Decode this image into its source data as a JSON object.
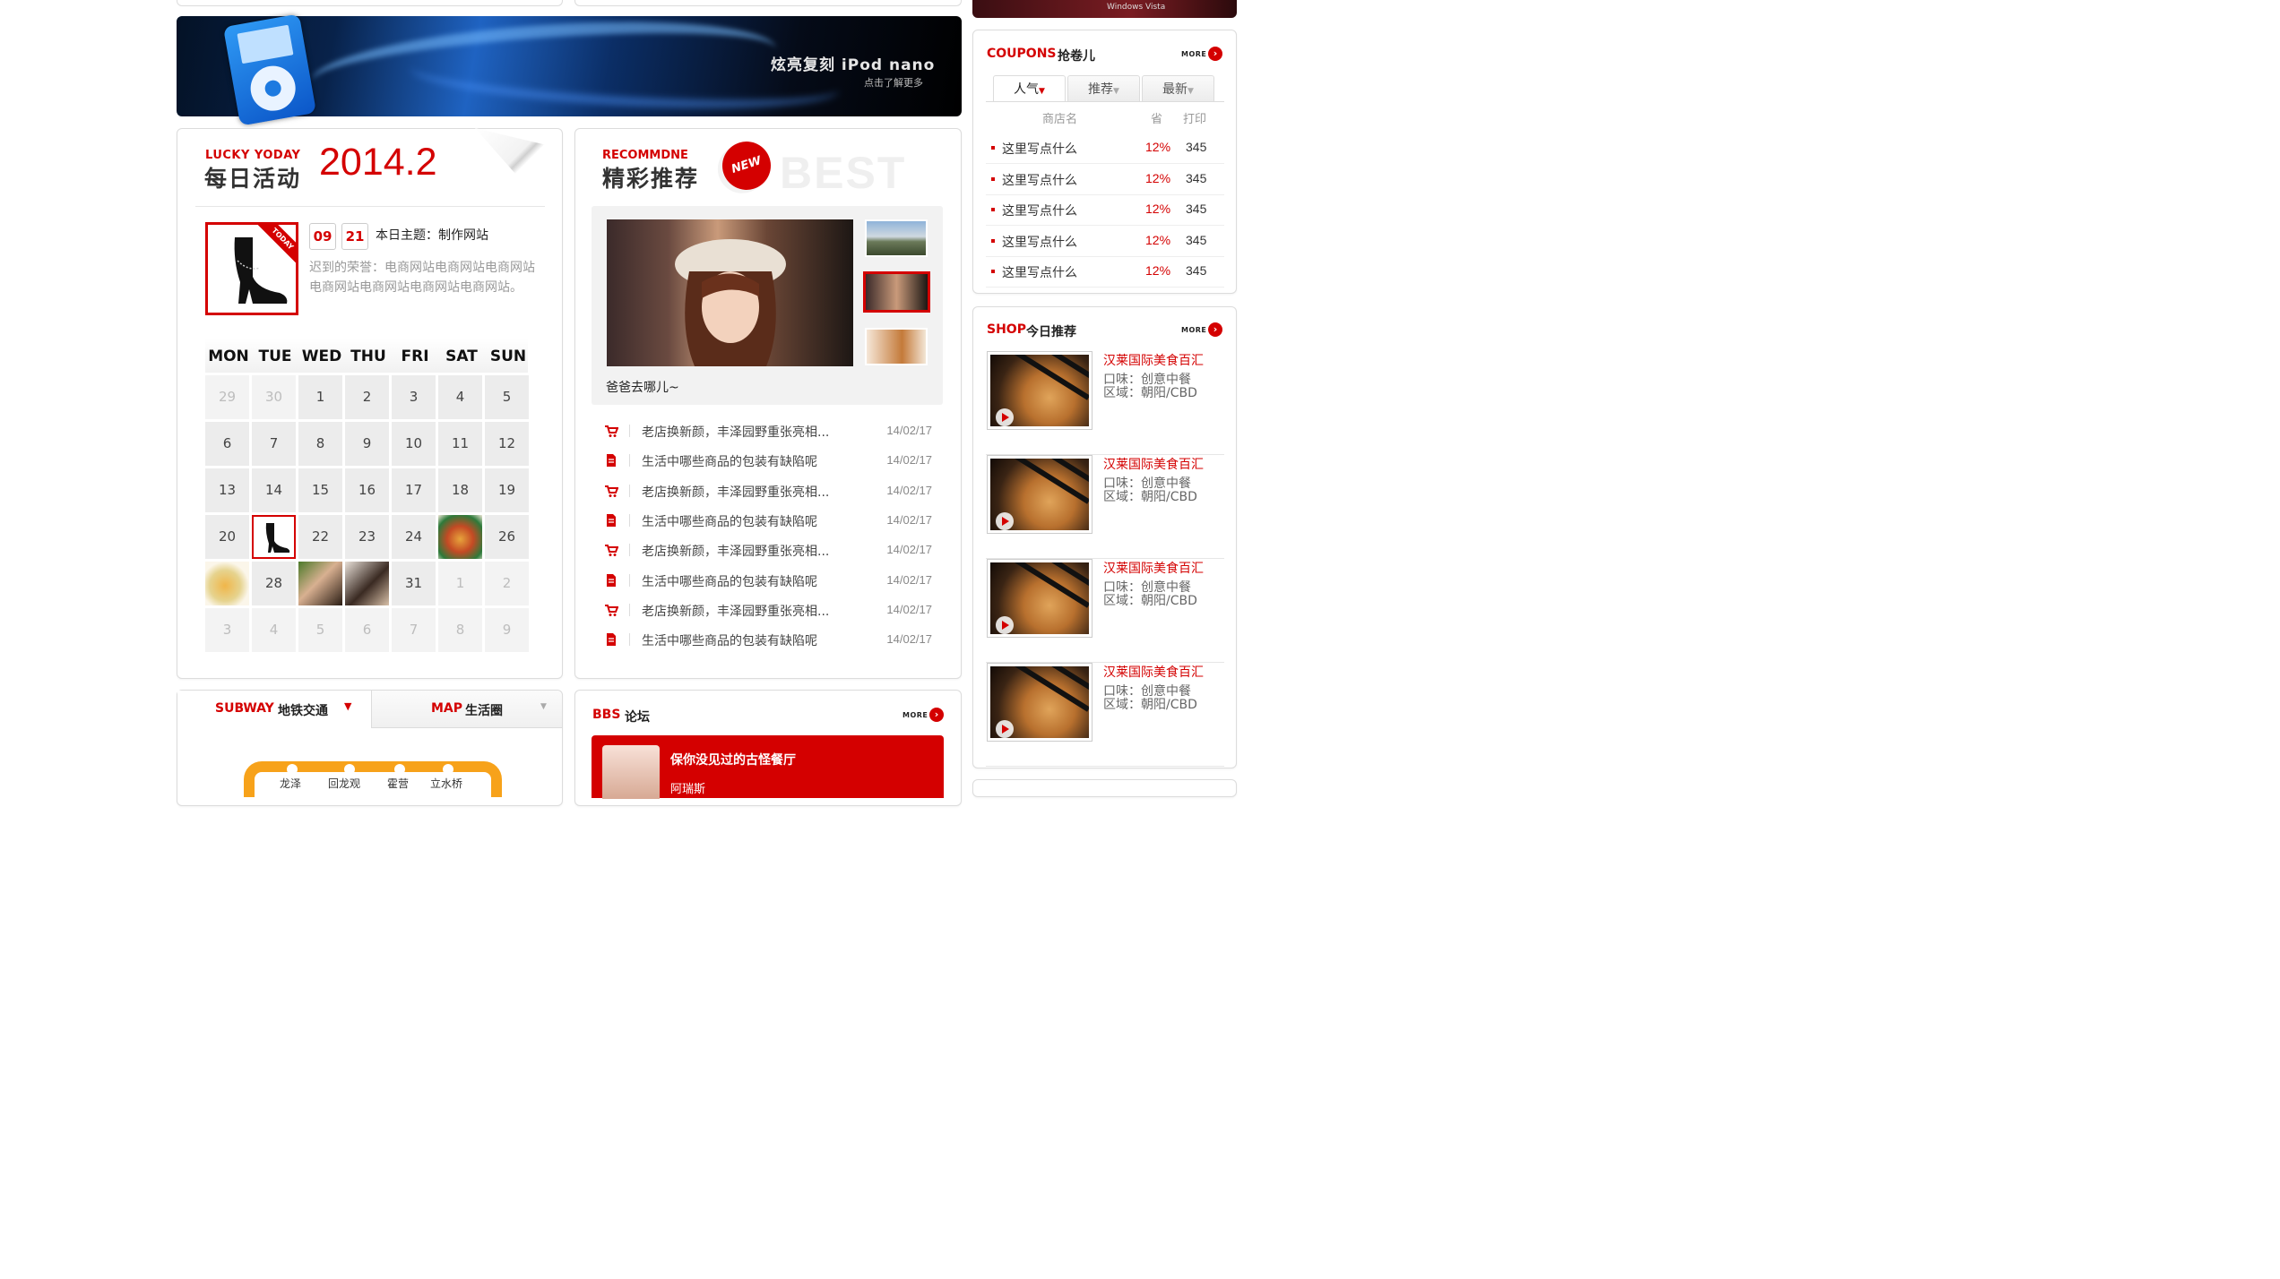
{
  "banner": {
    "text": "炫亮复刻  iPod nano",
    "sub": "点击了解更多",
    "top_right_brand": "Windows Vista"
  },
  "lucky": {
    "en_title": "LUCKY YODAY",
    "cn_title": "每日活动",
    "date": "2014.2",
    "today_badge": "TODAY",
    "month": "09",
    "day": "21",
    "theme": "本日主题：制作网站",
    "desc": "迟到的荣誉：电商网站电商网站电商网站电商网站电商网站电商网站电商网站。",
    "weekdays": [
      "MON",
      "TUE",
      "WED",
      "THU",
      "FRI",
      "SAT",
      "SUN"
    ],
    "calendar": [
      [
        "29",
        "30",
        "1",
        "2",
        "3",
        "4",
        "5"
      ],
      [
        "6",
        "7",
        "8",
        "9",
        "10",
        "11",
        "12"
      ],
      [
        "13",
        "14",
        "15",
        "16",
        "17",
        "18",
        "19"
      ],
      [
        "20",
        "",
        "22",
        "23",
        "24",
        "",
        "26"
      ],
      [
        "",
        "28",
        "",
        "",
        "31",
        "1",
        "2"
      ],
      [
        "3",
        "4",
        "5",
        "6",
        "7",
        "8",
        "9"
      ]
    ]
  },
  "recommend": {
    "en_title": "RECOMMDNE",
    "cn_title": "精彩推荐",
    "badge": "NEW",
    "watermark": "BEST",
    "caption": "爸爸去哪儿~",
    "news": [
      {
        "icon": "cart-icon",
        "title": "老店换新颜，丰泽园野重张亮相...",
        "date": "14/02/17"
      },
      {
        "icon": "doc-icon",
        "title": "生活中哪些商品的包装有缺陷呢",
        "date": "14/02/17"
      },
      {
        "icon": "cart-icon",
        "title": "老店换新颜，丰泽园野重张亮相...",
        "date": "14/02/17"
      },
      {
        "icon": "doc-icon",
        "title": "生活中哪些商品的包装有缺陷呢",
        "date": "14/02/17"
      },
      {
        "icon": "cart-icon",
        "title": "老店换新颜，丰泽园野重张亮相...",
        "date": "14/02/17"
      },
      {
        "icon": "doc-icon",
        "title": "生活中哪些商品的包装有缺陷呢",
        "date": "14/02/17"
      },
      {
        "icon": "cart-icon",
        "title": "老店换新颜，丰泽园野重张亮相...",
        "date": "14/02/17"
      },
      {
        "icon": "doc-icon",
        "title": "生活中哪些商品的包装有缺陷呢",
        "date": "14/02/17"
      }
    ]
  },
  "subway_tabs": {
    "subway_en": "SUBWAY",
    "subway_cn": "地铁交通",
    "map_en": "MAP",
    "map_cn": "生活圈",
    "stations": [
      "龙泽",
      "回龙观",
      "霍营",
      "立水桥"
    ]
  },
  "bbs": {
    "en": "BBS",
    "cn": "论坛",
    "more": "MORE",
    "headline": "保你没见过的古怪餐厅",
    "author": "阿瑞斯"
  },
  "coupons": {
    "en": "COUPONS",
    "cn": "抢卷儿",
    "more": "MORE",
    "tabs": [
      "人气",
      "推荐",
      "最新"
    ],
    "headers": {
      "name": "商店名",
      "save": "省",
      "print": "打印"
    },
    "rows": [
      {
        "name": "这里写点什么",
        "save": "12%",
        "print": "345"
      },
      {
        "name": "这里写点什么",
        "save": "12%",
        "print": "345"
      },
      {
        "name": "这里写点什么",
        "save": "12%",
        "print": "345"
      },
      {
        "name": "这里写点什么",
        "save": "12%",
        "print": "345"
      },
      {
        "name": "这里写点什么",
        "save": "12%",
        "print": "345"
      }
    ]
  },
  "shop": {
    "en": "SHOP",
    "cn": "今日推荐",
    "more": "MORE",
    "items": [
      {
        "name": "汉莱国际美食百汇",
        "taste": "口味：创意中餐",
        "area": "区域：朝阳/CBD"
      },
      {
        "name": "汉莱国际美食百汇",
        "taste": "口味：创意中餐",
        "area": "区域：朝阳/CBD"
      },
      {
        "name": "汉莱国际美食百汇",
        "taste": "口味：创意中餐",
        "area": "区域：朝阳/CBD"
      },
      {
        "name": "汉莱国际美食百汇",
        "taste": "口味：创意中餐",
        "area": "区域：朝阳/CBD"
      }
    ]
  },
  "colors": {
    "accent": "#d40000",
    "subway_line": "#f7a21a"
  }
}
